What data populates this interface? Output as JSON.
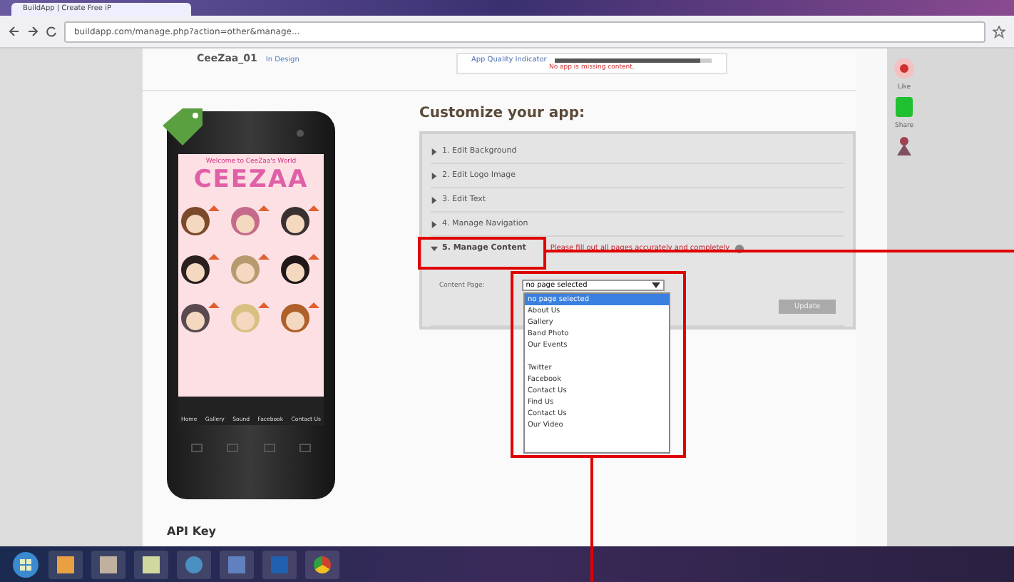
{
  "browser": {
    "tab_title": "BuildApp | Create Free iP",
    "url": "buildapp.com/manage.php?action=other&manage..."
  },
  "header": {
    "app_name": "CeeZaa_01",
    "status": "In Design",
    "quality_label": "App Quality Indicator",
    "quality_note": "No app is missing content.",
    "level": 0.92
  },
  "phone": {
    "welcome": "Welcome to CeeZaa's World",
    "logo": "CEEZAA",
    "nav": [
      "Home",
      "Gallery",
      "Sound",
      "Facebook",
      "Contact Us"
    ]
  },
  "customize": {
    "title": "Customize your app:",
    "steps": [
      {
        "label": "1. Edit Background",
        "expanded": false
      },
      {
        "label": "2. Edit Logo Image",
        "expanded": false
      },
      {
        "label": "3. Edit Text",
        "expanded": false
      },
      {
        "label": "4. Manage Navigation",
        "expanded": false
      },
      {
        "label": "5. Manage Content",
        "expanded": true,
        "warning": "Please fill out all pages accurately and completely"
      }
    ],
    "content_page": {
      "label": "Content Page:",
      "value": "no page selected",
      "options": [
        {
          "label": "no page selected",
          "selected": true
        },
        {
          "label": "About Us",
          "selected": false
        },
        {
          "label": "Gallery",
          "selected": false
        },
        {
          "label": "Band Photo",
          "selected": false
        },
        {
          "label": "Our Events",
          "selected": false
        },
        {
          "label": "Twitter",
          "selected": false
        },
        {
          "label": "Facebook",
          "selected": false
        },
        {
          "label": "Contact Us",
          "selected": false
        },
        {
          "label": "Find Us",
          "selected": false
        },
        {
          "label": "Contact Us",
          "selected": false
        },
        {
          "label": "Our Video",
          "selected": false
        }
      ]
    },
    "button": "Update"
  },
  "api_key": "API Key",
  "sidebar": [
    {
      "label": "Like"
    },
    {
      "label": "Share"
    }
  ]
}
